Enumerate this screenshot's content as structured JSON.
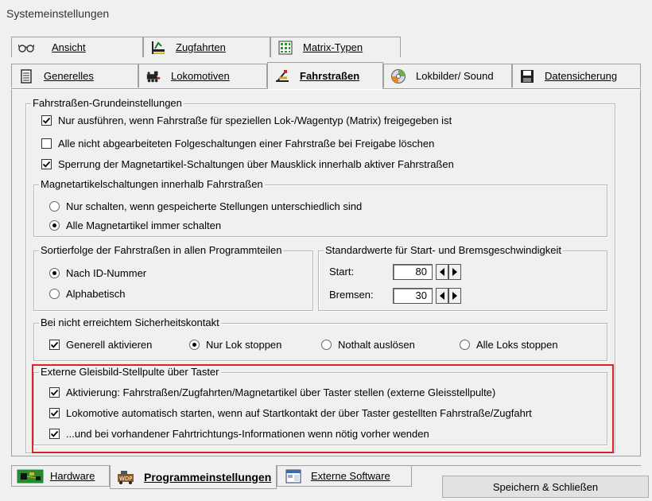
{
  "window": {
    "title": "Systemeinstellungen"
  },
  "tabs_row1": [
    {
      "label": "Ansicht",
      "icon": "glasses-icon"
    },
    {
      "label": "Zugfahrten",
      "icon": "train-route-icon"
    },
    {
      "label": "Matrix-Typen",
      "icon": "grid-icon"
    }
  ],
  "tabs_row2": [
    {
      "label": "Generelles",
      "icon": "document-icon"
    },
    {
      "label": "Lokomotiven",
      "icon": "locomotive-icon"
    },
    {
      "label": "Fahrstraßen",
      "icon": "route-icon",
      "active": true
    },
    {
      "label": "Lokbilder/ Sound",
      "icon": "cd-icon"
    },
    {
      "label": "Datensicherung",
      "icon": "floppy-icon"
    }
  ],
  "groups": {
    "grundeinstellungen": {
      "title": "Fahrstraßen-Grundeinstellungen",
      "options": [
        {
          "label": "Nur ausführen, wenn Fahrstraße für speziellen Lok-/Wagentyp (Matrix) freigegeben ist",
          "checked": true
        },
        {
          "label": "Alle nicht abgearbeiteten Folgeschaltungen einer Fahrstraße bei Freigabe löschen",
          "checked": false
        },
        {
          "label": "Sperrung der Magnetartikel-Schaltungen über Mausklick innerhalb aktiver Fahrstraßen",
          "checked": true
        }
      ]
    },
    "magnetartikel": {
      "title": "Magnetartikelschaltungen innerhalb Fahrstraßen",
      "options": [
        {
          "label": "Nur schalten, wenn gespeicherte Stellungen unterschiedlich sind",
          "selected": false
        },
        {
          "label": "Alle Magnetartikel immer schalten",
          "selected": true
        }
      ]
    },
    "sortierfolge": {
      "title": "Sortierfolge der Fahrstraßen in allen Programmteilen",
      "options": [
        {
          "label": "Nach ID-Nummer",
          "selected": true
        },
        {
          "label": "Alphabetisch",
          "selected": false
        }
      ]
    },
    "standardwerte": {
      "title": "Standardwerte  für Start- und Bremsgeschwindigkeit",
      "start_label": "Start:",
      "start_value": "80",
      "bremsen_label": "Bremsen:",
      "bremsen_value": "30"
    },
    "sicherheitskontakt": {
      "title": "Bei nicht erreichtem Sicherheitskontakt",
      "checkbox": {
        "label": "Generell aktivieren",
        "checked": true
      },
      "radios": [
        {
          "label": "Nur Lok stoppen",
          "selected": true
        },
        {
          "label": "Nothalt auslösen",
          "selected": false
        },
        {
          "label": "Alle Loks stoppen",
          "selected": false
        }
      ]
    },
    "extern": {
      "title": "Externe Gleisbild-Stellpulte über Taster",
      "options": [
        {
          "label": "Aktivierung: Fahrstraßen/Zugfahrten/Magnetartikel über Taster stellen (externe Gleisstellpulte)",
          "checked": true
        },
        {
          "label": "Lokomotive automatisch starten, wenn auf Startkontakt der über Taster gestellten Fahrstraße/Zugfahrt",
          "checked": true
        },
        {
          "label": "...und bei vorhandener Fahrtrichtungs-Informationen wenn nötig vorher wenden",
          "checked": true
        }
      ]
    }
  },
  "bottom_tabs": [
    {
      "label": "Hardware",
      "icon": "circuit-board-icon"
    },
    {
      "label": "Programmeinstellungen",
      "icon": "wdp-icon",
      "active": true
    },
    {
      "label": "Externe Software",
      "icon": "window-app-icon"
    }
  ],
  "save_button": "Speichern & Schließen",
  "colors": {
    "highlight": "#e0202a",
    "background": "#f0f0f0"
  }
}
